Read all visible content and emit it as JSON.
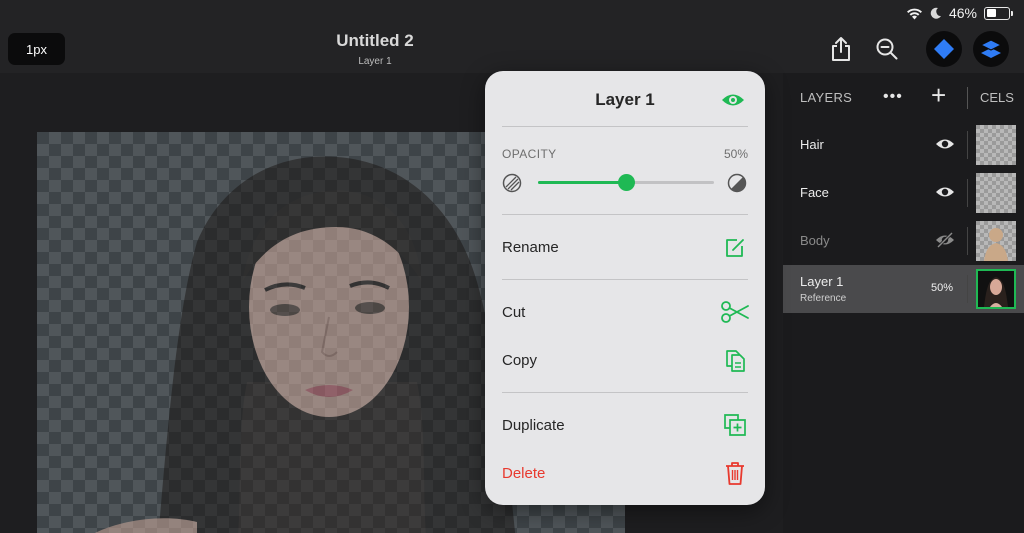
{
  "status_bar": {
    "battery": "46%",
    "battery_level": 0.46
  },
  "toolbar": {
    "brush_size": "1px",
    "document_title": "Untitled 2",
    "document_subtitle": "Layer 1"
  },
  "layers_panel": {
    "title": "LAYERS",
    "more": "•••",
    "add": "+",
    "cels": "CELS",
    "layers": [
      {
        "name": "Hair",
        "visible": true
      },
      {
        "name": "Face",
        "visible": true
      },
      {
        "name": "Body",
        "visible": false
      },
      {
        "name": "Layer 1",
        "subtitle": "Reference",
        "opacity": "50%",
        "selected": true
      }
    ]
  },
  "layer_menu": {
    "title": "Layer 1",
    "opacity_label": "OPACITY",
    "opacity_value": "50%",
    "opacity_level": 0.5,
    "items": {
      "rename": "Rename",
      "cut": "Cut",
      "copy": "Copy",
      "duplicate": "Duplicate",
      "delete": "Delete"
    }
  },
  "colors": {
    "accent": "#1fb954",
    "danger": "#e8392e",
    "active_tool": "#2f7cf6"
  }
}
